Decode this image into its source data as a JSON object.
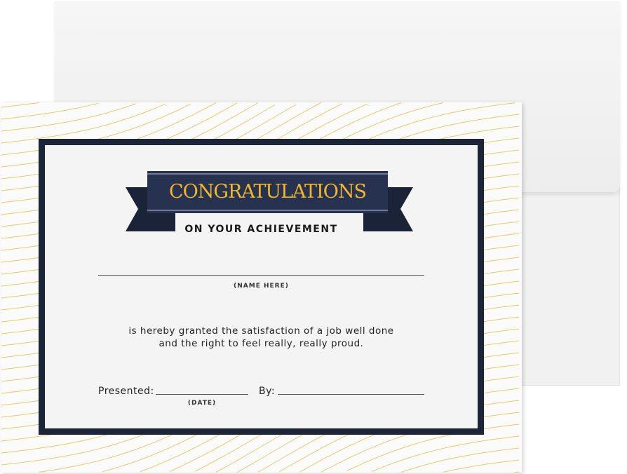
{
  "certificate": {
    "title": "CONGRATULATIONS",
    "subtitle": "ON YOUR ACHIEVEMENT",
    "name_caption": "(NAME HERE)",
    "body_line1": "is hereby granted the satisfaction of a job well done",
    "body_line2": "and the right to feel really, really proud.",
    "presented_label": "Presented:",
    "date_caption": "(DATE)",
    "by_label": "By:"
  },
  "colors": {
    "navy": "#1c2538",
    "gold": "#f0b72a",
    "wave": "#ecc868"
  }
}
